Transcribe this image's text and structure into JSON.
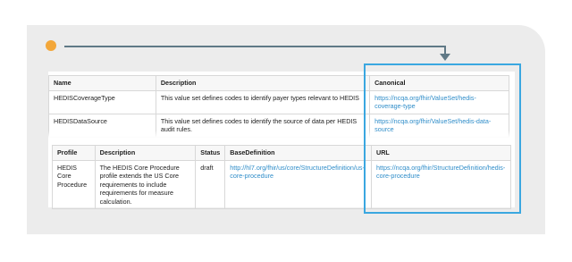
{
  "table1": {
    "headers": [
      "Name",
      "Description",
      "Canonical"
    ],
    "rows": [
      {
        "name": "HEDISCoverageType",
        "description": "This value set defines codes to identify payer types relevant to HEDIS",
        "canonical": "https://ncqa.org/fhir/ValueSet/hedis-coverage-type"
      },
      {
        "name": "HEDISDataSource",
        "description": "This value set defines codes to identify the source of data per HEDIS audit rules.",
        "canonical": "https://ncqa.org/fhir/ValueSet/hedis-data-source"
      }
    ]
  },
  "table2": {
    "headers": [
      "Profile",
      "Description",
      "Status",
      "BaseDefinition",
      "URL"
    ],
    "rows": [
      {
        "profile": "HEDIS Core Procedure",
        "description": "The HEDIS Core Procedure profile extends the US Core requirements to include requirements for measure calculation.",
        "status": "draft",
        "base": "http://hl7.org/fhir/us/core/StructureDefinition/us-core-procedure",
        "url": "https://ncqa.org/fhir/StructureDefinition/hedis-core-procedure"
      }
    ]
  },
  "colors": {
    "accent": "#3aa7e0",
    "dot": "#f3a73a",
    "connector": "#607986",
    "link": "#2f8dc9"
  }
}
